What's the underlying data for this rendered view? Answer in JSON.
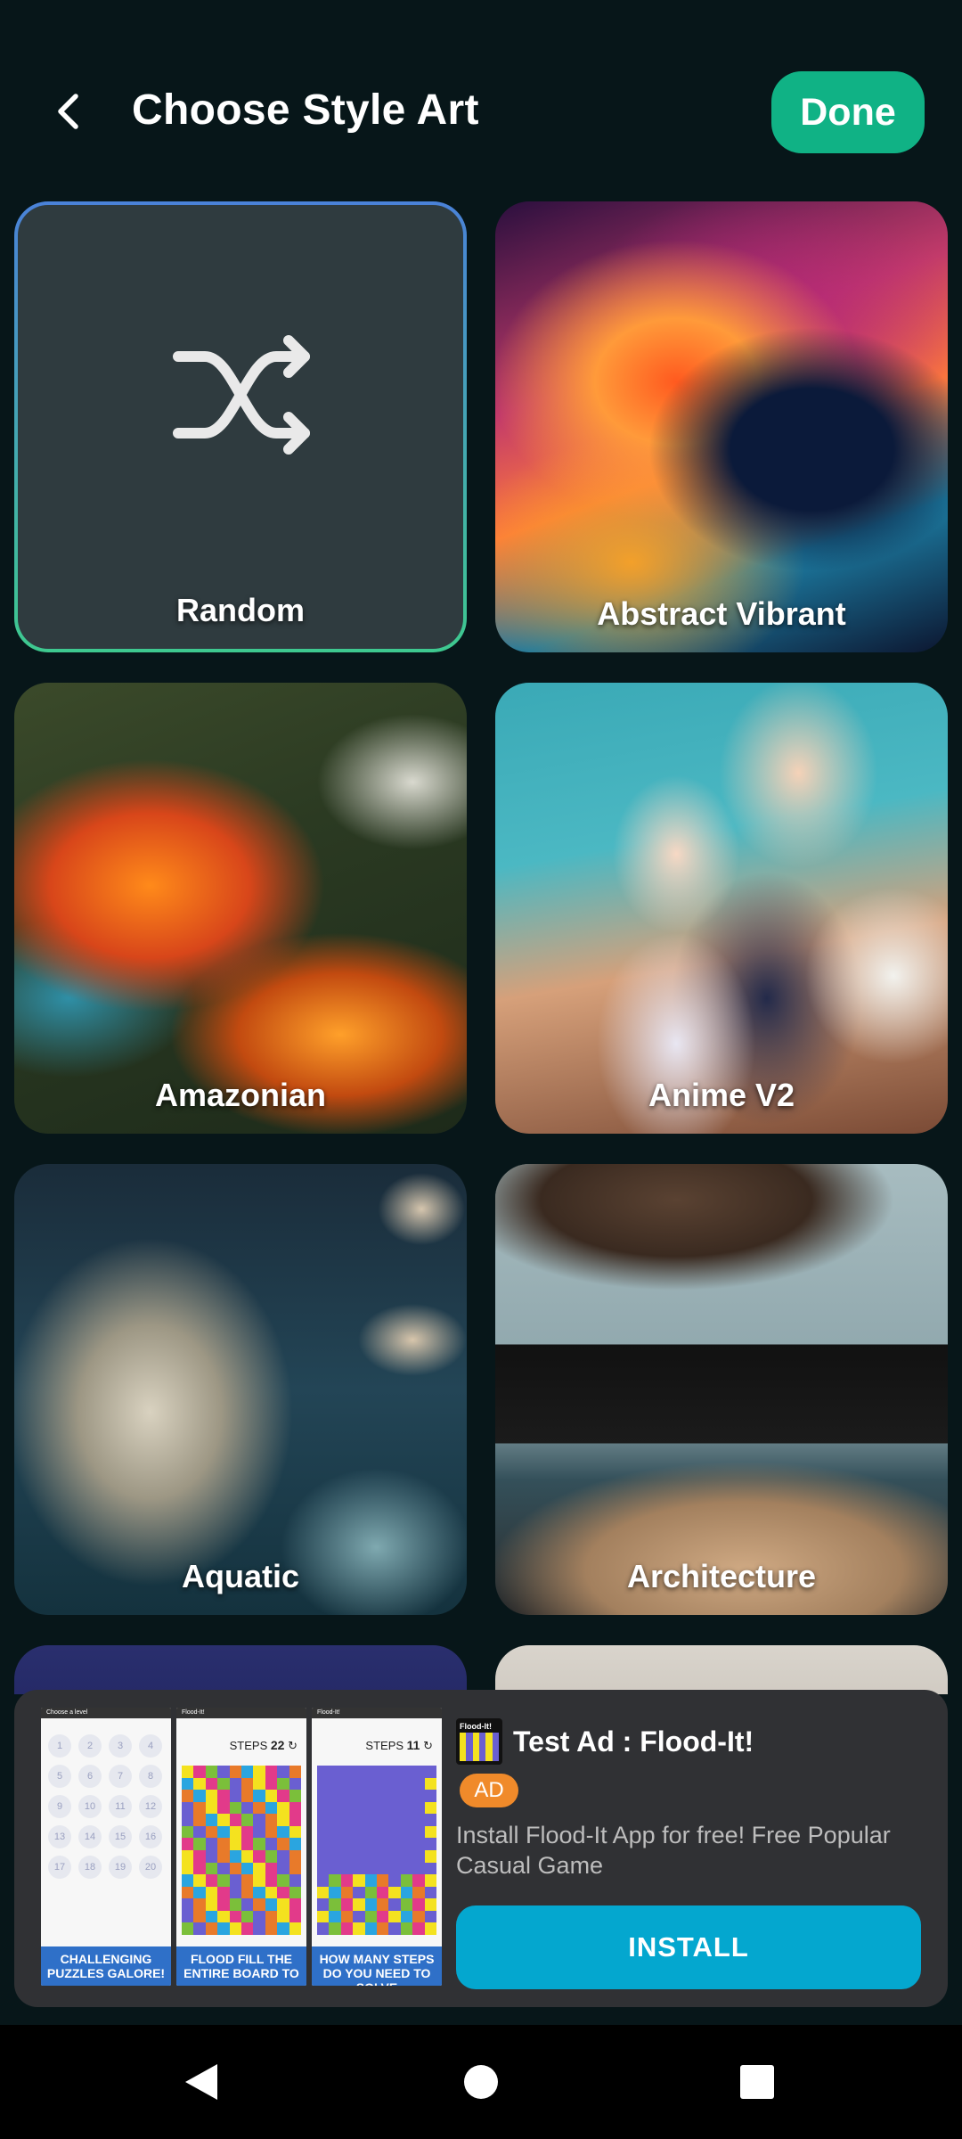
{
  "header": {
    "title": "Choose Style Art",
    "done_label": "Done",
    "back_icon": "chevron-left-icon"
  },
  "styles": [
    {
      "label": "Random",
      "selected": true,
      "icon": "shuffle-icon"
    },
    {
      "label": "Abstract Vibrant",
      "selected": false
    },
    {
      "label": "Amazonian",
      "selected": false
    },
    {
      "label": "Anime V2",
      "selected": false
    },
    {
      "label": "Aquatic",
      "selected": false
    },
    {
      "label": "Architecture",
      "selected": false
    }
  ],
  "ad": {
    "title": "Test Ad : Flood-It!",
    "badge": "AD",
    "description": "Install Flood-It App for free! Free Popular Casual Game",
    "install_label": "INSTALL",
    "icon_text": "Flood-It!",
    "screenshots": [
      {
        "topbar": "Choose a level",
        "numbers": [
          "1",
          "2",
          "3",
          "4",
          "5",
          "6",
          "7",
          "8",
          "9",
          "10",
          "11",
          "12",
          "13",
          "14",
          "15",
          "16",
          "17",
          "18",
          "19",
          "20"
        ],
        "caption": "CHALLENGING PUZZLES GALORE!"
      },
      {
        "topbar": "Flood-It!",
        "steps_label": "STEPS",
        "steps_value": "22",
        "caption": "FLOOD FILL THE ENTIRE BOARD TO"
      },
      {
        "topbar": "Flood-It!",
        "steps_label": "STEPS",
        "steps_value": "11",
        "caption": "HOW MANY STEPS DO YOU NEED TO SOLVE"
      }
    ]
  },
  "navbar": {
    "back_icon": "nav-back-icon",
    "home_icon": "nav-home-icon",
    "recents_icon": "nav-recents-icon"
  },
  "colors": {
    "background": "#071619",
    "accent": "#10b285",
    "install": "#04a7cf",
    "badge": "#f08a2a"
  }
}
